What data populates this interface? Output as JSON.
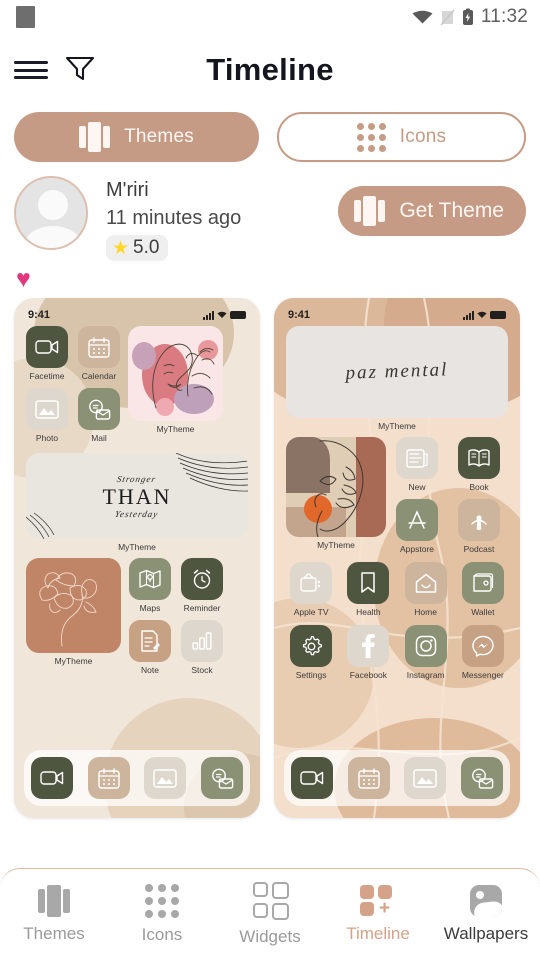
{
  "status_bar": {
    "time": "11:32",
    "icons": [
      "app-square-icon",
      "wifi-icon",
      "no-sim-icon",
      "battery-charging-icon"
    ]
  },
  "app_bar": {
    "title": "Timeline",
    "menu_icon": "hamburger-icon",
    "filter_icon": "filter-icon"
  },
  "segmented": {
    "themes": {
      "label": "Themes",
      "active": true,
      "icon": "theme-book-icon"
    },
    "icons": {
      "label": "Icons",
      "active": false,
      "icon": "dot-grid-icon"
    }
  },
  "author": {
    "name": "M'riri",
    "time": "11 minutes ago",
    "rating": "5.0",
    "star_icon": "star-icon",
    "avatar_icon": "avatar-placeholder-icon",
    "get_theme_label": "Get Theme"
  },
  "like": {
    "icon": "heart-icon",
    "liked": true
  },
  "previews": [
    {
      "id": "preview-left",
      "status_time": "9:41",
      "background": "#f0e6da",
      "top_apps": [
        {
          "name": "Facetime",
          "color": "#4e5640",
          "icon": "video-camera-icon"
        },
        {
          "name": "Calendar",
          "color": "#cdb49d",
          "icon": "calendar-icon"
        },
        {
          "name": "Photo",
          "color": "#ded7cd",
          "icon": "photo-icon"
        },
        {
          "name": "Mail",
          "color": "#8b9174",
          "icon": "mail-icon"
        }
      ],
      "widget_face": {
        "label": "MyTheme",
        "style": "pink-floral-face"
      },
      "widget_quote": {
        "label": "MyTheme",
        "line1": "Stronger",
        "line2": "THAN",
        "line3": "Yesterday"
      },
      "widget_bottom": {
        "label": "MyTheme",
        "style": "terracotta-floral-face"
      },
      "bottom_apps": [
        {
          "name": "Maps",
          "color": "#8b9174",
          "icon": "map-icon"
        },
        {
          "name": "Reminder",
          "color": "#4e5640",
          "icon": "alarm-clock-icon"
        },
        {
          "name": "Note",
          "color": "#c6a184",
          "icon": "note-icon"
        },
        {
          "name": "Stock",
          "color": "#ded7cd",
          "icon": "chart-bars-icon"
        }
      ],
      "dock": [
        {
          "name": "Facetime",
          "color": "#4e5640",
          "icon": "video-camera-icon"
        },
        {
          "name": "Calendar",
          "color": "#cdb49d",
          "icon": "calendar-icon"
        },
        {
          "name": "Photo",
          "color": "#ded7cd",
          "icon": "photo-icon"
        },
        {
          "name": "Mail",
          "color": "#8b9174",
          "icon": "mail-icon"
        }
      ]
    },
    {
      "id": "preview-right",
      "status_time": "9:41",
      "background": "#f3dfcb",
      "widget_quote": {
        "label": "MyTheme",
        "text": "paz mental"
      },
      "widget_face": {
        "label": "MyTheme",
        "style": "earth-tone-face"
      },
      "apps_row1": [
        {
          "name": "New",
          "color": "#ded7cd",
          "icon": "news-icon"
        },
        {
          "name": "Book",
          "color": "#4e5640",
          "icon": "book-icon"
        }
      ],
      "apps_row2": [
        {
          "name": "Appstore",
          "color": "#8b9174",
          "icon": "appstore-icon"
        },
        {
          "name": "Podcast",
          "color": "#cdb49d",
          "icon": "podcast-icon"
        }
      ],
      "apps_row3": [
        {
          "name": "Apple TV",
          "color": "#ded7cd",
          "icon": "tv-icon"
        },
        {
          "name": "Health",
          "color": "#4e5640",
          "icon": "bookmark-icon"
        },
        {
          "name": "Home",
          "color": "#cdb49d",
          "icon": "home-icon"
        },
        {
          "name": "Wallet",
          "color": "#8b9174",
          "icon": "wallet-icon"
        }
      ],
      "apps_row4": [
        {
          "name": "Settings",
          "color": "#4e5640",
          "icon": "gear-icon"
        },
        {
          "name": "Facebook",
          "color": "#ded7cd",
          "icon": "facebook-icon"
        },
        {
          "name": "Instagram",
          "color": "#8b9174",
          "icon": "instagram-icon"
        },
        {
          "name": "Messenger",
          "color": "#c6a184",
          "icon": "messenger-icon"
        }
      ],
      "dock": [
        {
          "name": "Facetime",
          "color": "#4e5640",
          "icon": "video-camera-icon"
        },
        {
          "name": "Calendar",
          "color": "#cdb49d",
          "icon": "calendar-icon"
        },
        {
          "name": "Photo",
          "color": "#ded7cd",
          "icon": "photo-icon"
        },
        {
          "name": "Mail",
          "color": "#8b9174",
          "icon": "mail-icon"
        }
      ]
    }
  ],
  "bottom_nav": {
    "items": [
      {
        "label": "Themes",
        "icon": "theme-book-icon",
        "state": "inactive"
      },
      {
        "label": "Icons",
        "icon": "dot-grid-icon",
        "state": "inactive"
      },
      {
        "label": "Widgets",
        "icon": "widgets-icon",
        "state": "inactive"
      },
      {
        "label": "Timeline",
        "icon": "timeline-icon",
        "state": "active"
      },
      {
        "label": "Wallpapers",
        "icon": "wallpaper-icon",
        "state": "dark"
      }
    ]
  },
  "colors": {
    "accent": "#c69b85",
    "accent_light": "#d3a288",
    "heart": "#e0397e",
    "star": "#ffd827",
    "olive_dark": "#4e5640",
    "sage": "#8b9174",
    "tan": "#cdb49d",
    "cream": "#ded7cd"
  }
}
